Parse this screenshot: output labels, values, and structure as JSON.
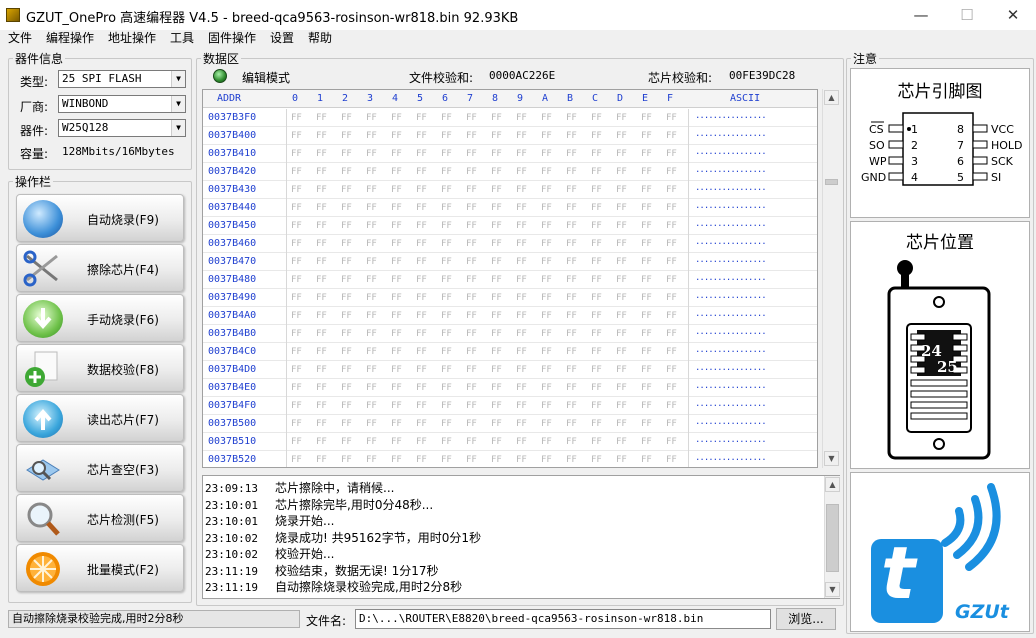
{
  "window": {
    "title": "GZUT_OnePro 高速编程器 V4.5 - breed-qca9563-rosinson-wr818.bin   92.93KB",
    "minimize_glyph": "—",
    "maximize_glyph": "☐",
    "close_glyph": "✕"
  },
  "menu": [
    "文件",
    "编程操作",
    "地址操作",
    "工具",
    "固件操作",
    "设置",
    "帮助"
  ],
  "device_info": {
    "legend": "器件信息",
    "type_label": "类型:",
    "type_value": "25 SPI FLASH",
    "vendor_label": "厂商:",
    "vendor_value": "WINBOND",
    "device_label": "器件:",
    "device_value": "W25Q128",
    "capacity_label": "容量:",
    "capacity_value": "128Mbits/16Mbytes"
  },
  "operations": {
    "legend": "操作栏",
    "buttons": [
      {
        "label": "自动烧录(F9)",
        "icon": "globe-icon"
      },
      {
        "label": "擦除芯片(F4)",
        "icon": "scissors-icon"
      },
      {
        "label": "手动烧录(F6)",
        "icon": "download-arrow-icon"
      },
      {
        "label": "数据校验(F8)",
        "icon": "document-add-icon"
      },
      {
        "label": "读出芯片(F7)",
        "icon": "upload-arrow-icon"
      },
      {
        "label": "芯片查空(F3)",
        "icon": "search-book-icon"
      },
      {
        "label": "芯片检测(F5)",
        "icon": "magnifier-icon"
      },
      {
        "label": "批量模式(F2)",
        "icon": "orange-slice-icon"
      }
    ]
  },
  "data_area": {
    "legend": "数据区",
    "mode": "编辑模式",
    "file_checksum_label": "文件校验和:",
    "file_checksum_value": "0000AC226E",
    "chip_checksum_label": "芯片校验和:",
    "chip_checksum_value": "00FE39DC28",
    "header_addr": "ADDR",
    "header_cols": [
      "0",
      "1",
      "2",
      "3",
      "4",
      "5",
      "6",
      "7",
      "8",
      "9",
      "A",
      "B",
      "C",
      "D",
      "E",
      "F"
    ],
    "header_ascii": "ASCII",
    "cell_value": "FF",
    "ascii_value": "................",
    "rows": [
      "0037B3F0",
      "0037B400",
      "0037B410",
      "0037B420",
      "0037B430",
      "0037B440",
      "0037B450",
      "0037B460",
      "0037B470",
      "0037B480",
      "0037B490",
      "0037B4A0",
      "0037B4B0",
      "0037B4C0",
      "0037B4D0",
      "0037B4E0",
      "0037B4F0",
      "0037B500",
      "0037B510",
      "0037B520"
    ]
  },
  "log": [
    {
      "time": "23:09:13",
      "msg": "芯片擦除中，请稍候..."
    },
    {
      "time": "23:10:01",
      "msg": "芯片擦除完毕,用时0分48秒..."
    },
    {
      "time": "23:10:01",
      "msg": "烧录开始..."
    },
    {
      "time": "23:10:02",
      "msg": "烧录成功! 共95162字节，用时0分1秒"
    },
    {
      "time": "23:10:02",
      "msg": "校验开始..."
    },
    {
      "time": "23:11:19",
      "msg": "校验结束，数据无误! 1分17秒"
    },
    {
      "time": "23:11:19",
      "msg": "自动擦除烧录校验完成,用时2分8秒"
    }
  ],
  "notes": {
    "legend": "注意",
    "pinout_title": "芯片引脚图",
    "pins_left": [
      {
        "name": "CS",
        "num": "1"
      },
      {
        "name": "SO",
        "num": "2"
      },
      {
        "name": "WP",
        "num": "3"
      },
      {
        "name": "GND",
        "num": "4"
      }
    ],
    "pins_right": [
      {
        "name": "VCC",
        "num": "8"
      },
      {
        "name": "HOLD",
        "num": "7"
      },
      {
        "name": "SCK",
        "num": "6"
      },
      {
        "name": "SI",
        "num": "5"
      }
    ],
    "position_title": "芯片位置",
    "chip_label_top": "24",
    "chip_label_bottom": "25",
    "logo_letter": "t",
    "logo_brand": "GZUt"
  },
  "statusbar": {
    "status_text": "自动擦除烧录校验完成,用时2分8秒",
    "filename_label": "文件名:",
    "filename_value": "D:\\...\\ROUTER\\E8820\\breed-qca9563-rosinson-wr818.bin",
    "browse_label": "浏览..."
  },
  "colors": {
    "addr_blue": "#1f3fd0",
    "ff_gray": "#b8b8b8",
    "logo_blue": "#1a8fe0",
    "led_green": "#2e8b2e"
  }
}
